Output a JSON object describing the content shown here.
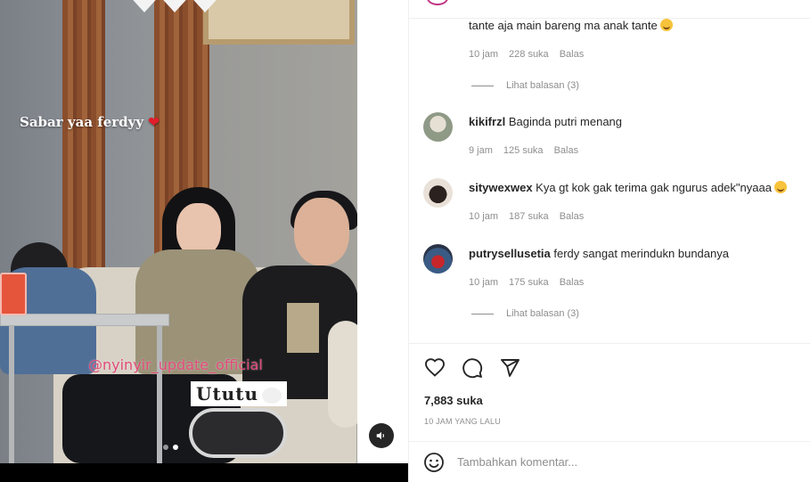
{
  "media": {
    "caption": "Sabar yaa ferdyy",
    "caption_emoji": "❤",
    "watermark": "@nyinyir_update_official",
    "sticker_text": "Ututu",
    "carousel_dots": 2,
    "active_dot": 2,
    "mute_icon": "speaker-muted-icon"
  },
  "comments": [
    {
      "username": "",
      "text": "tante aja main bareng ma anak tante",
      "emoji": "smiling-face-emoji",
      "time": "10 jam",
      "likes": "228 suka",
      "reply": "Balas",
      "view_replies": "Lihat balasan (3)"
    },
    {
      "username": "kikifrzl",
      "text": "Baginda putri menang",
      "time": "9 jam",
      "likes": "125 suka",
      "reply": "Balas"
    },
    {
      "username": "sitywexwex",
      "text": "Kya gt kok gak terima gak ngurus adek\"nyaaa",
      "emoji": "laughing-face-emoji",
      "time": "10 jam",
      "likes": "187 suka",
      "reply": "Balas"
    },
    {
      "username": "putrysellusetia",
      "text": "ferdy sangat merindukn bundanya",
      "time": "10 jam",
      "likes": "175 suka",
      "reply": "Balas",
      "view_replies": "Lihat balasan (3)"
    }
  ],
  "actions": {
    "icons": [
      "heart-icon",
      "comment-icon",
      "share-icon"
    ]
  },
  "likes_total": "7,883 suka",
  "posted_ago": "10 JAM YANG LALU",
  "add_comment": {
    "emoji_icon": "emoji-icon",
    "placeholder": "Tambahkan komentar..."
  }
}
